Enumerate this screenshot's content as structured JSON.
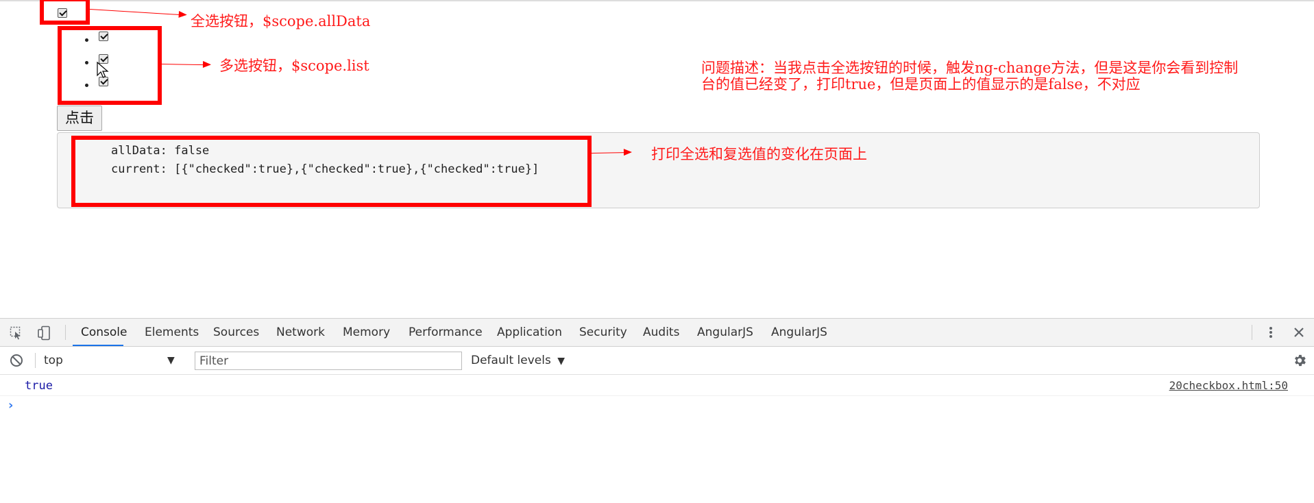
{
  "page": {
    "item_count": 3,
    "click_button": "点击",
    "output": {
      "line1": "allData: false",
      "line2": "current: [{\"checked\":true},{\"checked\":true},{\"checked\":true}]"
    }
  },
  "annotations": {
    "select_all": "全选按钮，$scope.allData",
    "multi_select": "多选按钮，$scope.list",
    "problem_line1": "问题描述：当我点击全选按钮的时候，触发ng-change方法，但是这是你会看到控制",
    "problem_line2": "台的值已经变了，打印true，但是页面上的值显示的是false，不对应",
    "output_note": "打印全选和复选值的变化在页面上",
    "accent": "#ff0000"
  },
  "devtools": {
    "tabs": [
      "Console",
      "Elements",
      "Sources",
      "Network",
      "Memory",
      "Performance",
      "Application",
      "Security",
      "Audits",
      "AngularJS",
      "AngularJS"
    ],
    "active_tab": "Console",
    "context": "top",
    "filter_placeholder": "Filter",
    "levels": "Default levels",
    "log": {
      "value": "true",
      "source": "20checkbox.html:50"
    },
    "prompt": "›"
  }
}
